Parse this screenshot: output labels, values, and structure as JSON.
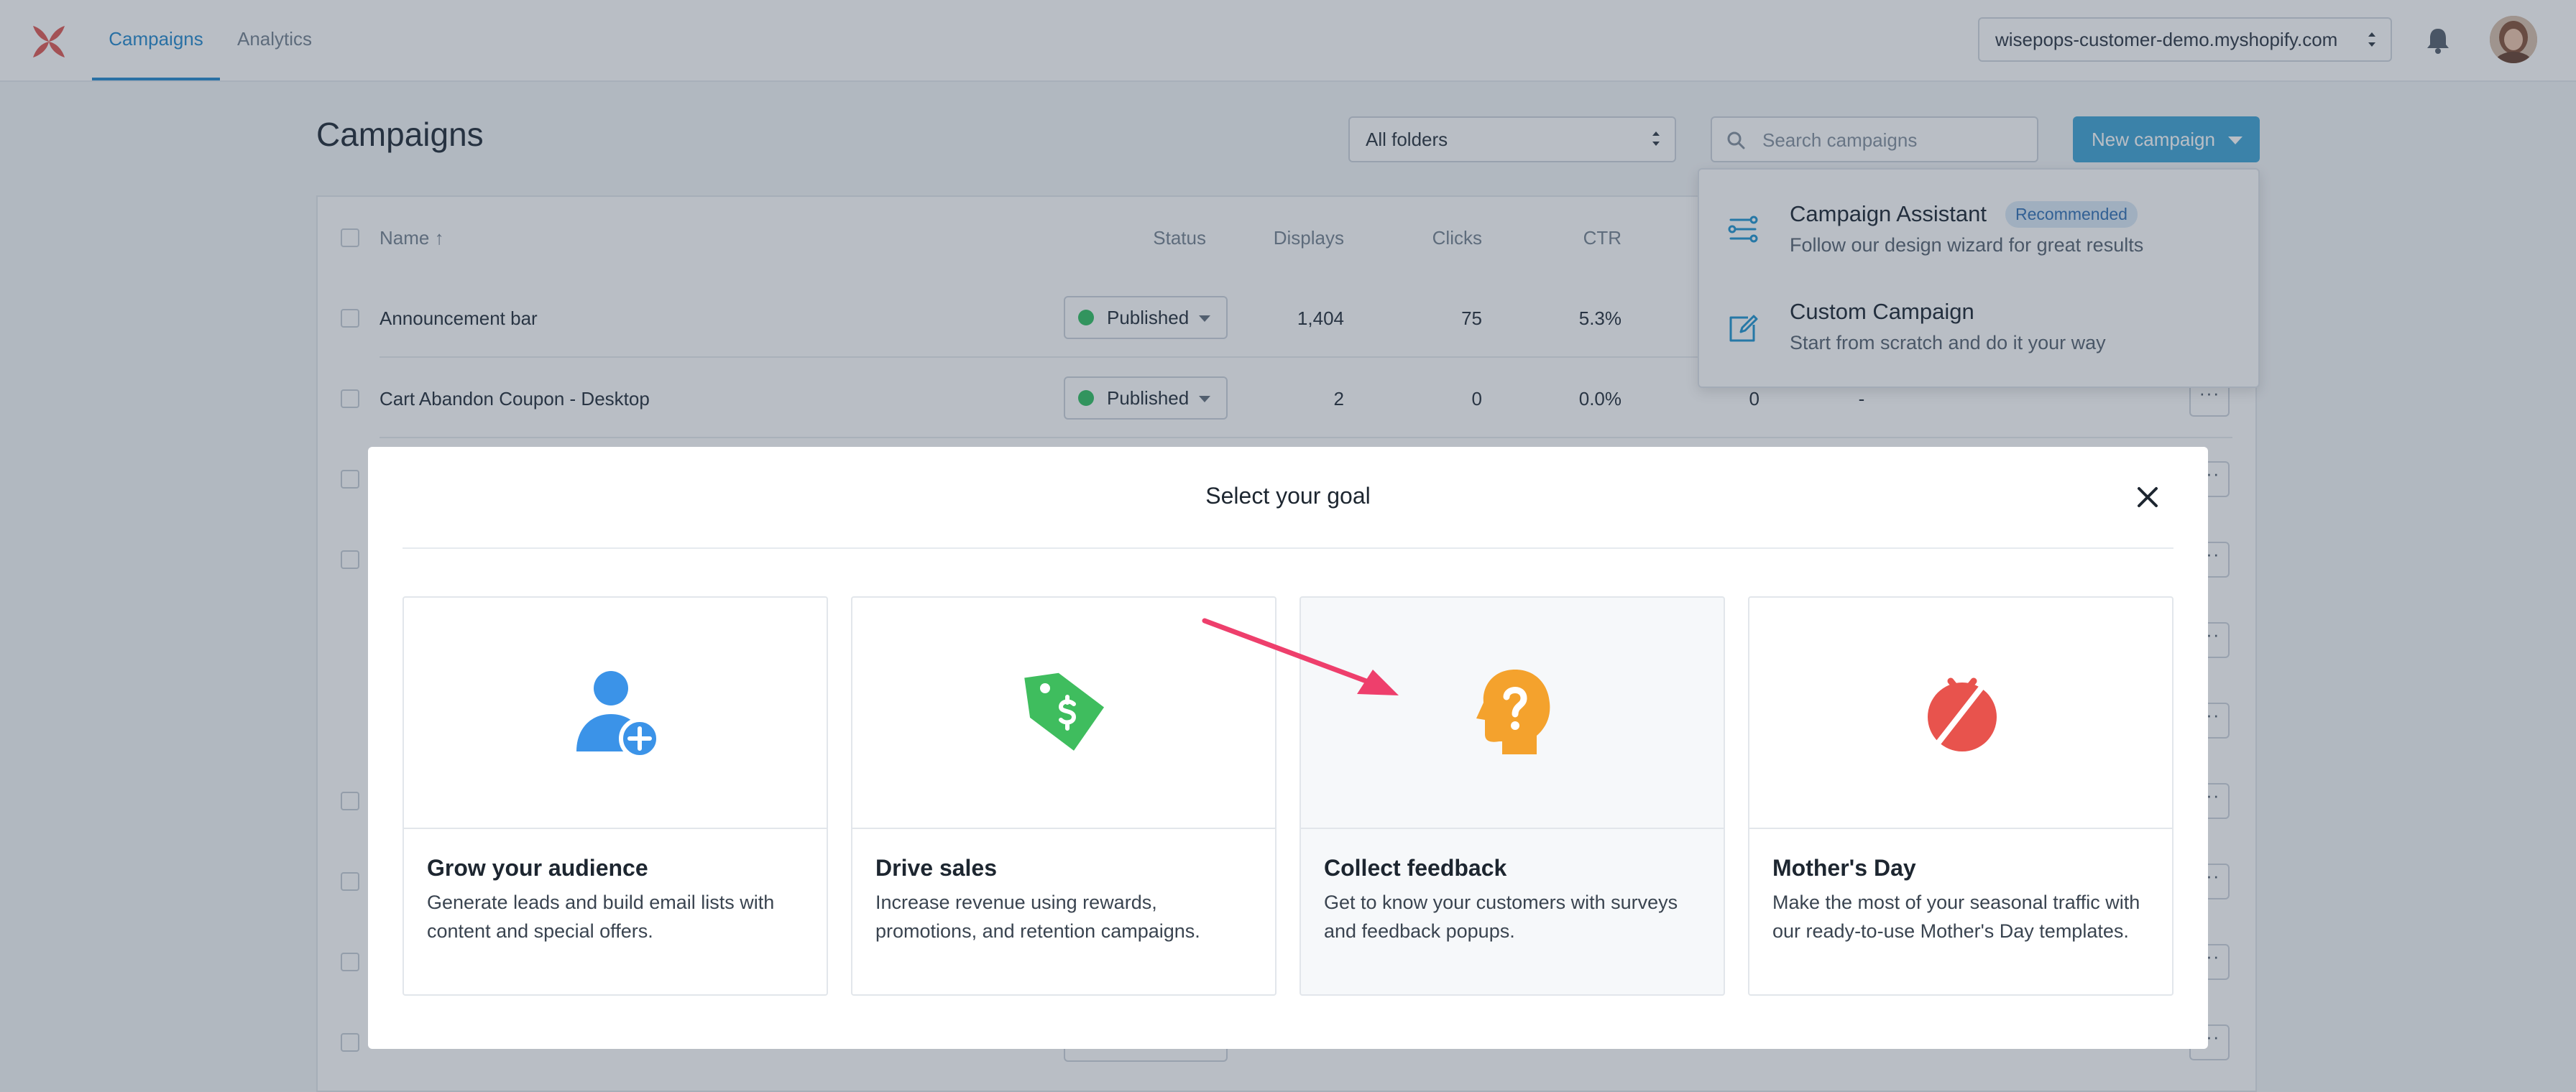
{
  "nav": {
    "tabs": [
      "Campaigns",
      "Analytics"
    ],
    "store": "wisepops-customer-demo.myshopify.com"
  },
  "page": {
    "title": "Campaigns",
    "folder_select": "All folders",
    "search_placeholder": "Search campaigns",
    "new_campaign": "New campaign"
  },
  "table": {
    "headers": {
      "name": "Name ↑",
      "status": "Status",
      "displays": "Displays",
      "clicks": "Clicks",
      "ctr": "CTR"
    },
    "rows": [
      {
        "name": "Announcement bar",
        "status": "Published",
        "displays": "1,404",
        "clicks": "75",
        "ctr": "5.3%",
        "extra1": "",
        "extra2": ""
      },
      {
        "name": "Cart Abandon Coupon - Desktop",
        "status": "Published",
        "displays": "2",
        "clicks": "0",
        "ctr": "0.0%",
        "extra1": "0",
        "extra2": "-"
      }
    ],
    "more_label": "···"
  },
  "dropdown": {
    "items": [
      {
        "title": "Campaign Assistant",
        "badge": "Recommended",
        "subtitle": "Follow our design wizard for great results",
        "icon": "wizard-icon"
      },
      {
        "title": "Custom Campaign",
        "badge": "",
        "subtitle": "Start from scratch and do it your way",
        "icon": "edit-icon"
      }
    ]
  },
  "modal": {
    "title": "Select your goal",
    "cards": [
      {
        "title": "Grow your audience",
        "description": "Generate leads and build email lists with content and special offers.",
        "icon": "add-user-icon",
        "color": "#3b93e8"
      },
      {
        "title": "Drive sales",
        "description": "Increase revenue using rewards, promotions, and retention campaigns.",
        "icon": "price-tag-icon",
        "color": "#3fbd5e"
      },
      {
        "title": "Collect feedback",
        "description": "Get to know your customers with surveys and feedback popups.",
        "icon": "head-question-icon",
        "color": "#f4a22d"
      },
      {
        "title": "Mother's Day",
        "description": "Make the most of your seasonal traffic with our ready-to-use Mother's Day templates.",
        "icon": "mothers-day-icon",
        "color": "#e8534d"
      }
    ]
  },
  "colors": {
    "accent": "#49a9d7",
    "published_dot": "#3cc26b",
    "annotation_arrow": "#ee3f6c"
  }
}
